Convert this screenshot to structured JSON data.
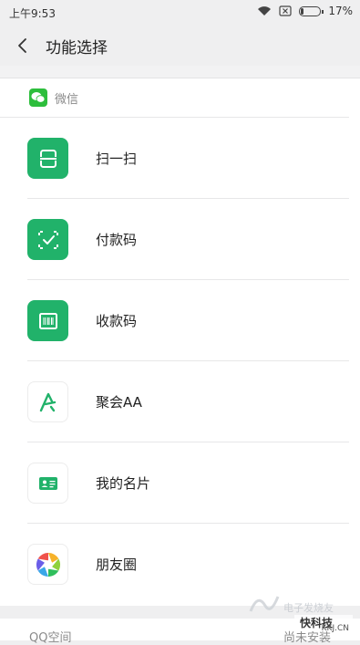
{
  "status": {
    "time": "上午9:53",
    "battery": "17%",
    "battery_level": 0.17
  },
  "header": {
    "title": "功能选择"
  },
  "section": {
    "title": "微信"
  },
  "items": [
    {
      "label": "扫一扫",
      "icon": "scan-icon"
    },
    {
      "label": "付款码",
      "icon": "pay-code-icon"
    },
    {
      "label": "收款码",
      "icon": "receive-code-icon"
    },
    {
      "label": "聚会AA",
      "icon": "aa-icon"
    },
    {
      "label": "我的名片",
      "icon": "business-card-icon"
    },
    {
      "label": "朋友圈",
      "icon": "moments-icon"
    }
  ],
  "next_section": {
    "title": "QQ空间",
    "status": "尚未安装"
  },
  "watermark": {
    "brand": "快科技",
    "domain": "KKJ.CN",
    "site": "电子发烧友"
  },
  "colors": {
    "accent": "#21b26a",
    "wechat": "#2dbe3c"
  }
}
